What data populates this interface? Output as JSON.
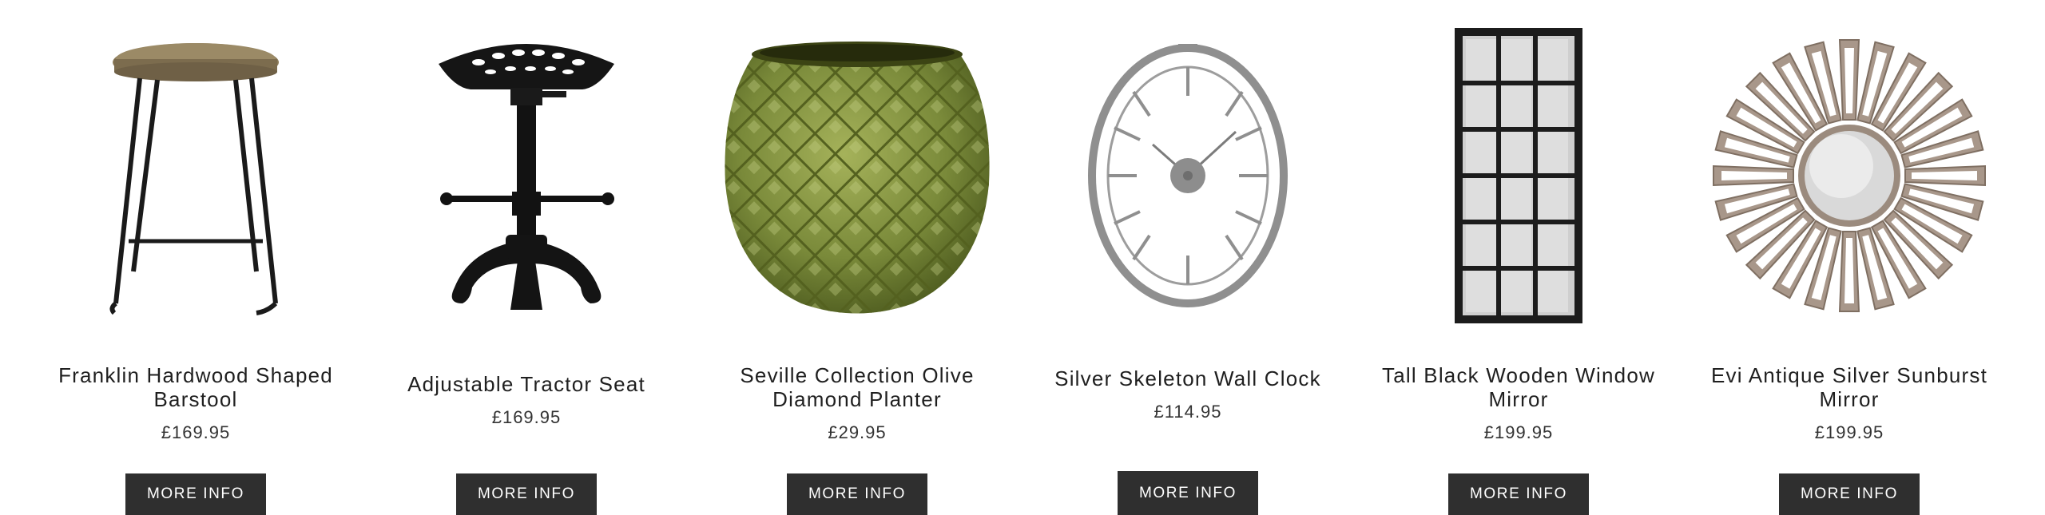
{
  "products": [
    {
      "name": "Franklin Hardwood Shaped Barstool",
      "price": "£169.95",
      "button_label": "MORE INFO",
      "icon": "barstool-image"
    },
    {
      "name": "Adjustable Tractor Seat",
      "price": "£169.95",
      "button_label": "MORE INFO",
      "icon": "tractor-seat-image"
    },
    {
      "name": "Seville Collection Olive Diamond Planter",
      "price": "£29.95",
      "button_label": "MORE INFO",
      "icon": "planter-image"
    },
    {
      "name": "Silver Skeleton Wall Clock",
      "price": "£114.95",
      "button_label": "MORE INFO",
      "icon": "wall-clock-image"
    },
    {
      "name": "Tall Black Wooden Window Mirror",
      "price": "£199.95",
      "button_label": "MORE INFO",
      "icon": "window-mirror-image"
    },
    {
      "name": "Evi Antique Silver Sunburst Mirror",
      "price": "£199.95",
      "button_label": "MORE INFO",
      "icon": "sunburst-mirror-image"
    }
  ],
  "colors": {
    "button_bg": "#2f2f2f",
    "button_text": "#ffffff",
    "planter_green": "#7a8a3a",
    "clock_silver": "#9a9a9a",
    "mirror_frame": "#1c1c1c",
    "sunburst_wood": "#a8978a"
  }
}
